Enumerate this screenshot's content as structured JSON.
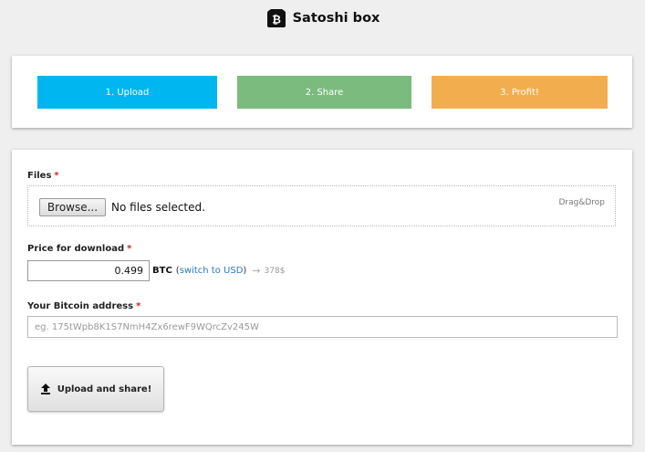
{
  "header": {
    "title": "Satoshi box",
    "logo_icon": "bitcoin-box-icon"
  },
  "steps": [
    {
      "label": "1. Upload",
      "color": "#00b6f0"
    },
    {
      "label": "2. Share",
      "color": "#7bbb7e"
    },
    {
      "label": "3. Profit!",
      "color": "#f2ae4e"
    }
  ],
  "form": {
    "files": {
      "label": "Files",
      "required_mark": "*",
      "browse_label": "Browse...",
      "no_files_text": "No files selected.",
      "dragdrop_text": "Drag&Drop"
    },
    "price": {
      "label": "Price for download",
      "required_mark": "*",
      "value": "0.499",
      "unit": "BTC",
      "paren_open": "(",
      "switch_label": "switch to USD",
      "paren_close": ")",
      "arrow_icon": "arrow-right-icon",
      "usd_value": "378$"
    },
    "address": {
      "label": "Your Bitcoin address",
      "required_mark": "*",
      "placeholder": "eg. 175tWpb8K1S7NmH4Zx6rewF9WQrcZv245W",
      "value": ""
    },
    "submit": {
      "label": "Upload and share!",
      "icon": "upload-icon"
    }
  },
  "colors": {
    "accent_link": "#2a79c0",
    "required": "#c62828",
    "background": "#efefef"
  }
}
